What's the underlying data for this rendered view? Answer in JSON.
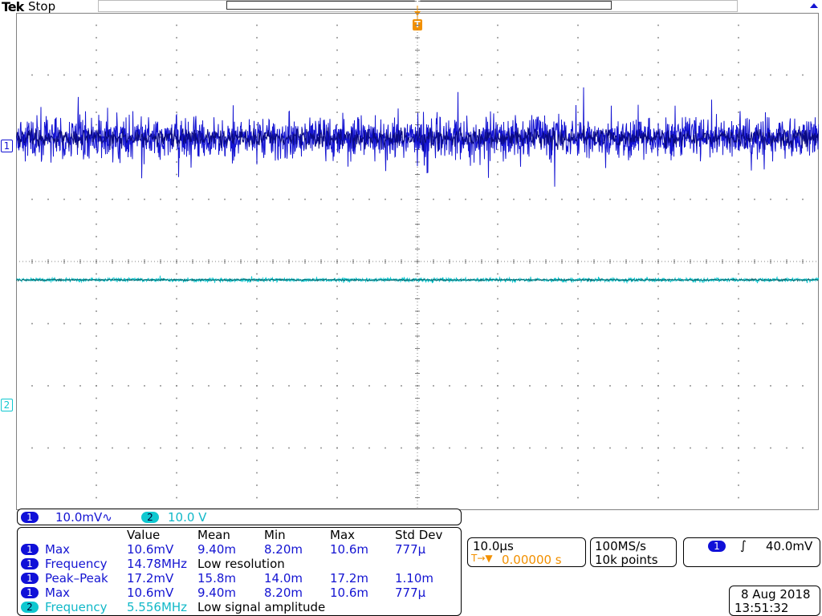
{
  "header": {
    "logo": "Tek",
    "status": "Stop"
  },
  "markers": {
    "trigger_pos": "T",
    "trigger_label": "T",
    "ch1": "1",
    "ch2": "2"
  },
  "channel_bar": {
    "ch1": {
      "label": "1",
      "scale": "10.0mV",
      "coupling": "∿"
    },
    "ch2": {
      "label": "2",
      "scale": "10.0 V"
    }
  },
  "measurements": {
    "headers": [
      "Value",
      "Mean",
      "Min",
      "Max",
      "Std Dev"
    ],
    "rows": [
      {
        "ch": "1",
        "name": "Max",
        "value": "10.6mV",
        "mean": "9.40m",
        "min": "8.20m",
        "max": "10.6m",
        "std": "777µ"
      },
      {
        "ch": "1",
        "name": "Frequency",
        "value": "14.78MHz",
        "note": "Low resolution"
      },
      {
        "ch": "1",
        "name": "Peak–Peak",
        "value": "17.2mV",
        "mean": "15.8m",
        "min": "14.0m",
        "max": "17.2m",
        "std": "1.10m"
      },
      {
        "ch": "1",
        "name": "Max",
        "value": "10.6mV",
        "mean": "9.40m",
        "min": "8.20m",
        "max": "10.6m",
        "std": "777µ"
      },
      {
        "ch": "2",
        "name": "Frequency",
        "value": "5.556MHz",
        "note": "Low signal amplitude"
      }
    ]
  },
  "timebase": {
    "scale": "10.0µs",
    "delay_icon": "T→▼",
    "delay": "0.00000 s"
  },
  "acquisition": {
    "rate": "100MS/s",
    "points": "10k points"
  },
  "trigger": {
    "source": "1",
    "slope": "∫",
    "level": "40.0mV"
  },
  "datetime": {
    "date": "8 Aug 2018",
    "time": "13:51:32"
  },
  "colors": {
    "ch1": "#1414d2",
    "ch2": "#10c8d0",
    "trigger": "#f29000",
    "grid": "#808080"
  }
}
